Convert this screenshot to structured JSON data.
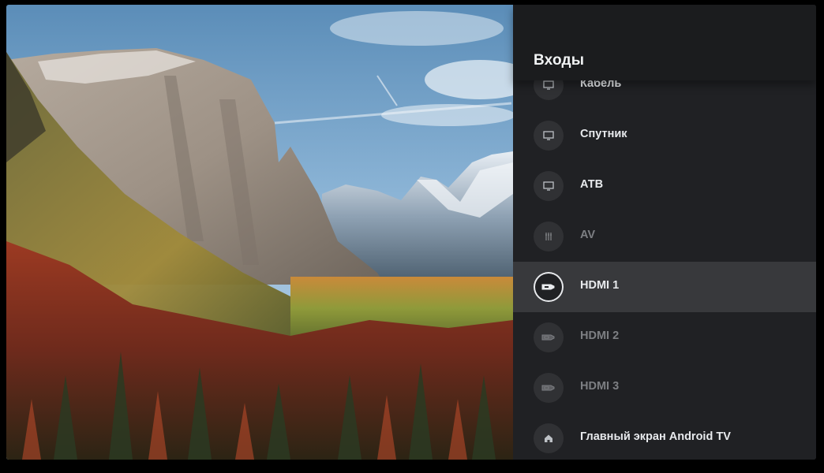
{
  "panel": {
    "title": "Входы",
    "items": [
      {
        "label": "Кабель",
        "icon": "tv-icon",
        "dimmed": false,
        "selected": false
      },
      {
        "label": "Спутник",
        "icon": "tv-icon",
        "dimmed": false,
        "selected": false
      },
      {
        "label": "АТВ",
        "icon": "tv-icon",
        "dimmed": false,
        "selected": false
      },
      {
        "label": "AV",
        "icon": "av-connector-icon",
        "dimmed": true,
        "selected": false
      },
      {
        "label": "HDMI 1",
        "icon": "hdmi-icon",
        "dimmed": false,
        "selected": true
      },
      {
        "label": "HDMI 2",
        "icon": "hdmi-icon",
        "dimmed": true,
        "selected": false
      },
      {
        "label": "HDMI 3",
        "icon": "hdmi-icon",
        "dimmed": true,
        "selected": false
      },
      {
        "label": "Главный экран Android TV",
        "icon": "home-icon",
        "dimmed": false,
        "selected": false
      }
    ]
  },
  "colors": {
    "panel_bg": "#202124",
    "header_bg": "#1b1c1e",
    "selected_bg": "#38393c",
    "text": "#e8eaed",
    "text_dim": "#7d7f83"
  }
}
